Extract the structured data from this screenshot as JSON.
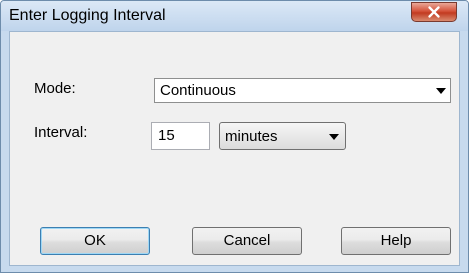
{
  "window": {
    "title": "Enter Logging Interval"
  },
  "mode": {
    "label": "Mode:",
    "value": "Continuous"
  },
  "interval": {
    "label": "Interval:",
    "value": "15",
    "unit": "minutes"
  },
  "buttons": {
    "ok": "OK",
    "cancel": "Cancel",
    "help": "Help"
  },
  "icons": {
    "close": "close-icon",
    "dropdown": "chevron-down-icon"
  },
  "colors": {
    "titlebar": "#c7daee",
    "close_button": "#c8442a",
    "dialog_background": "#f0f0f0",
    "default_button_border": "#3c7fb1"
  }
}
